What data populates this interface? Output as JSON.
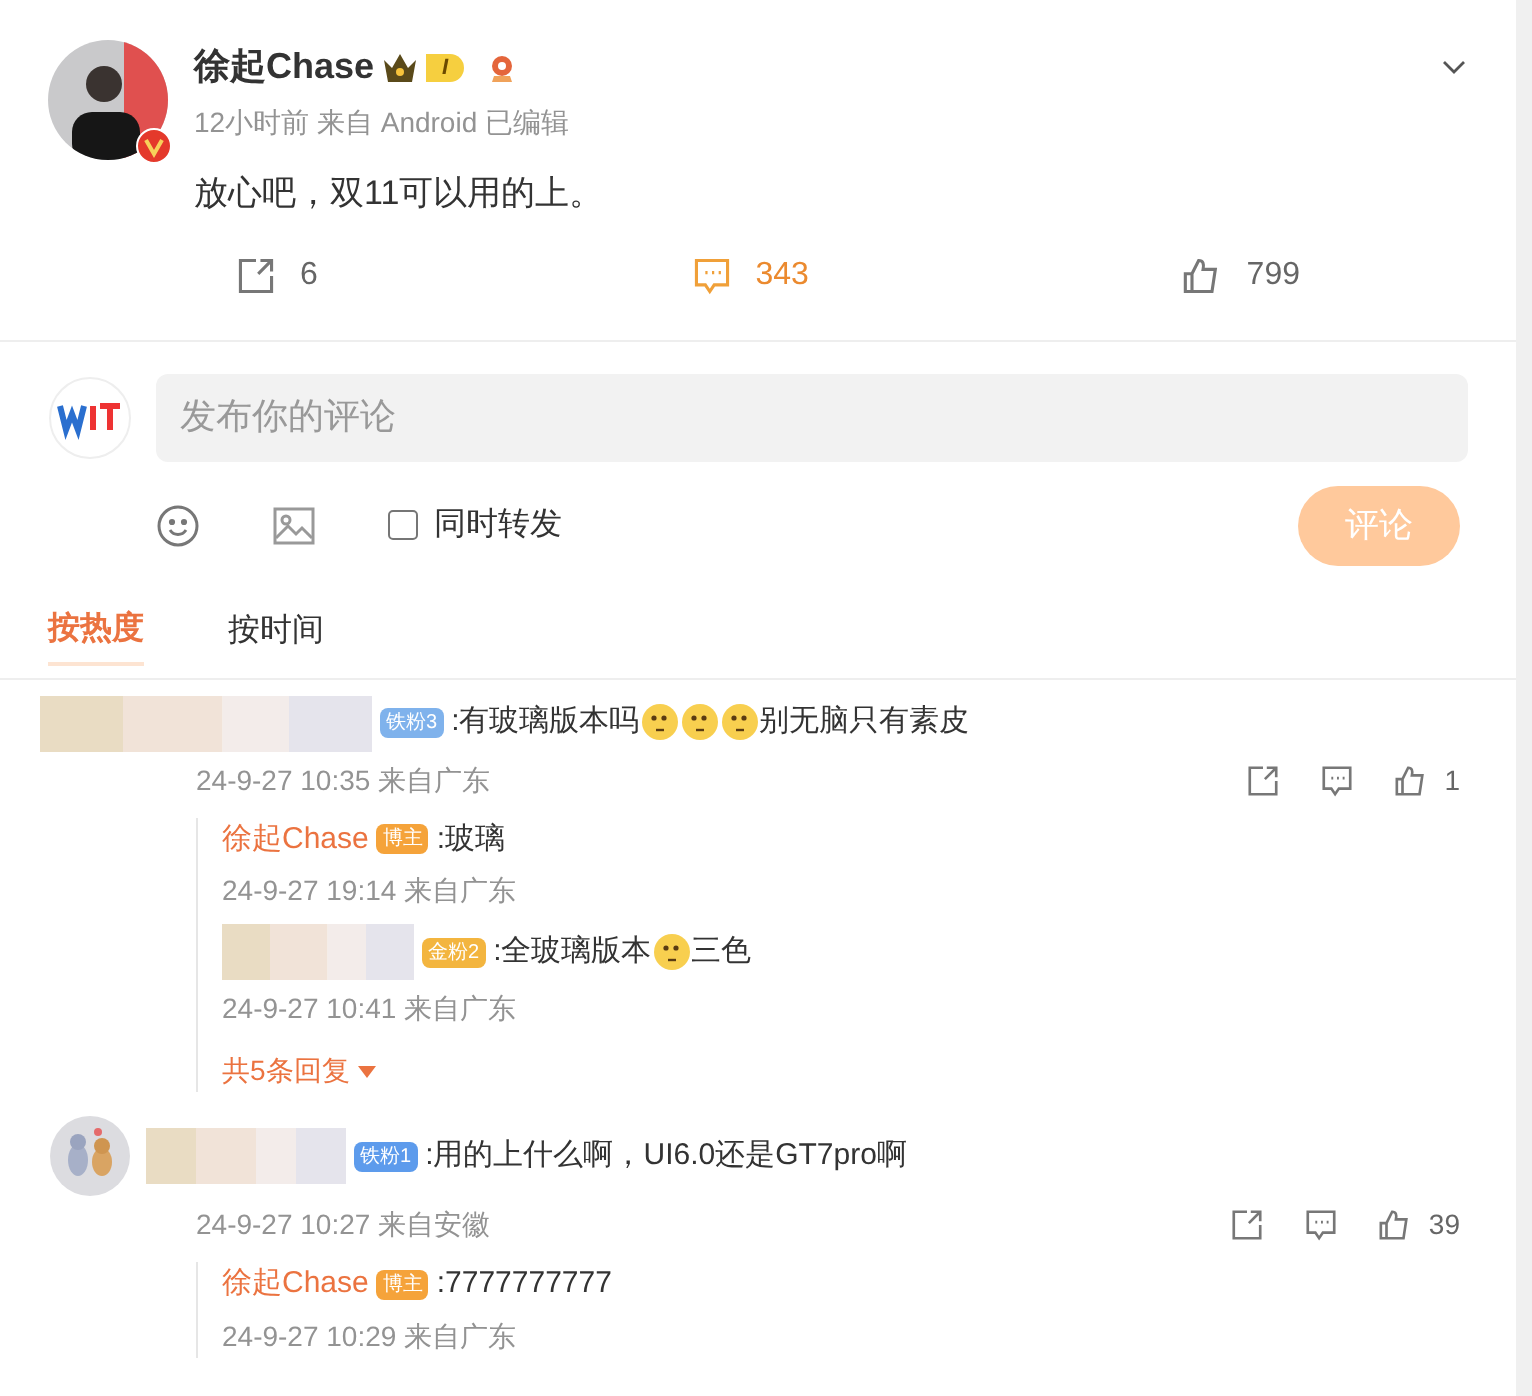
{
  "post": {
    "author": "徐起Chase",
    "level_badge": "I",
    "meta": "12小时前 来自 Android 已编辑",
    "content": "放心吧，双11可以用的上。",
    "actions": [
      {
        "kind": "share",
        "count": "6",
        "selected": false
      },
      {
        "kind": "comment",
        "count": "343",
        "selected": true
      },
      {
        "kind": "like",
        "count": "799",
        "selected": false
      }
    ]
  },
  "composer": {
    "placeholder": "发布你的评论",
    "repost_label": "同时转发",
    "repost_checked": false,
    "submit": "评论"
  },
  "sort_tabs": [
    {
      "label": "按热度",
      "selected": true
    },
    {
      "label": "按时间",
      "selected": false
    }
  ],
  "comments": [
    {
      "kind": "blurred",
      "badge": "铁粉3",
      "color": "#7fb2ec",
      "content": [
        {
          "kind": "text",
          "text": ":有玻璃版本吗"
        },
        {
          "kind": "emoji"
        },
        {
          "kind": "emoji"
        },
        {
          "kind": "emoji"
        },
        {
          "kind": "text",
          "text": "别无脑只有素皮"
        }
      ],
      "time": "24-9-27 10:35 来自广东",
      "likes": "1",
      "replies": [
        {
          "author": "徐起Chase",
          "badge": "博主",
          "color": "#f5a33a",
          "content": [
            {
              "kind": "text",
              "text": ":玻璃"
            }
          ],
          "time": "24-9-27 19:14 来自广东"
        },
        {
          "badge": "金粉2",
          "color": "#f3b53f",
          "content": [
            {
              "kind": "text",
              "text": ":全玻璃版本"
            },
            {
              "kind": "emoji"
            },
            {
              "kind": "text",
              "text": "三色"
            }
          ],
          "time": "24-9-27 10:41 来自广东"
        }
      ],
      "more": "共5条回复"
    },
    {
      "kind": "picture",
      "badge": "铁粉1",
      "color": "#5d9bec",
      "content": [
        {
          "kind": "text",
          "text": ":用的上什么啊，UI6.0还是GT7pro啊"
        }
      ],
      "time": "24-9-27 10:27 来自安徽",
      "likes": "39",
      "replies": [
        {
          "author": "徐起Chase",
          "badge": "博主",
          "color": "#f5a33a",
          "content": [
            {
              "kind": "text",
              "text": ":7777777777"
            }
          ],
          "time": "24-9-27 10:29 来自广东"
        }
      ]
    }
  ]
}
